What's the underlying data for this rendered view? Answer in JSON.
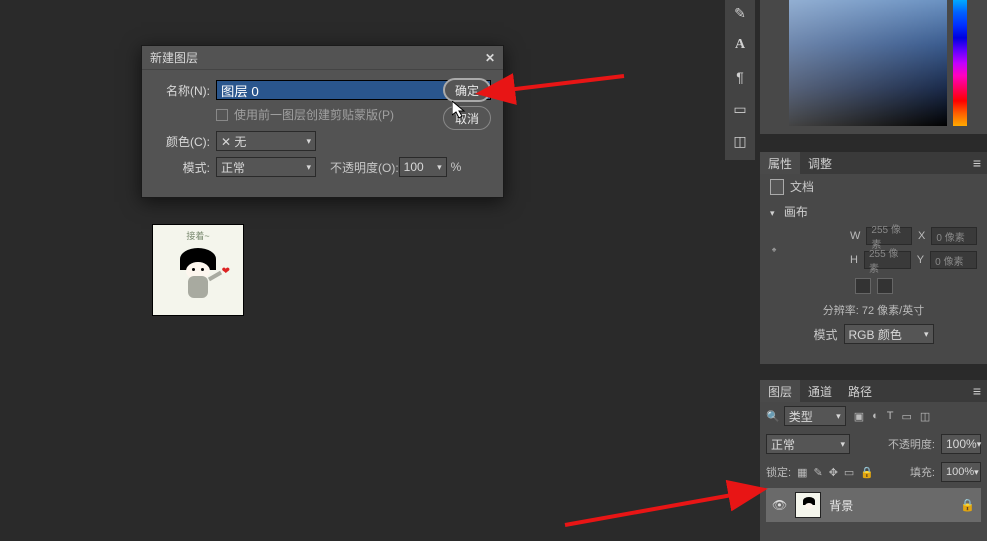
{
  "dialog": {
    "title": "新建图层",
    "name_label": "名称(N):",
    "name_value": "图层 0",
    "clip_label": "使用前一图层创建剪贴蒙版(P)",
    "color_label": "颜色(C):",
    "color_value": "✕ 无",
    "mode_label": "模式:",
    "mode_value": "正常",
    "opacity_label": "不透明度(O):",
    "opacity_value": "100",
    "opacity_unit": "%",
    "ok": "确定",
    "cancel": "取消"
  },
  "thumb": {
    "caption": "接着~"
  },
  "panels": {
    "properties_tab": "属性",
    "adjust_tab": "调整",
    "doc_label": "文档",
    "canvas_section": "画布",
    "w": "W",
    "h": "H",
    "x": "X",
    "y": "Y",
    "w_val": "255 像素",
    "h_val": "255 像素",
    "x_val": "0 像素",
    "y_val": "0 像素",
    "resolution": "分辨率: 72 像素/英寸",
    "mode_label": "模式",
    "mode_value": "RGB 颜色"
  },
  "layers": {
    "tab_layers": "图层",
    "tab_channels": "通道",
    "tab_paths": "路径",
    "kind": "类型",
    "blend": "正常",
    "opacity_label": "不透明度:",
    "opacity_value": "100%",
    "lock_label": "锁定:",
    "fill_label": "填充:",
    "fill_value": "100%",
    "layer_name": "背景"
  },
  "tool_icons": [
    "pen",
    "type",
    "ellipsis",
    "doc",
    "frame"
  ],
  "icons": {
    "search": "🔍",
    "collapse": "≡"
  }
}
